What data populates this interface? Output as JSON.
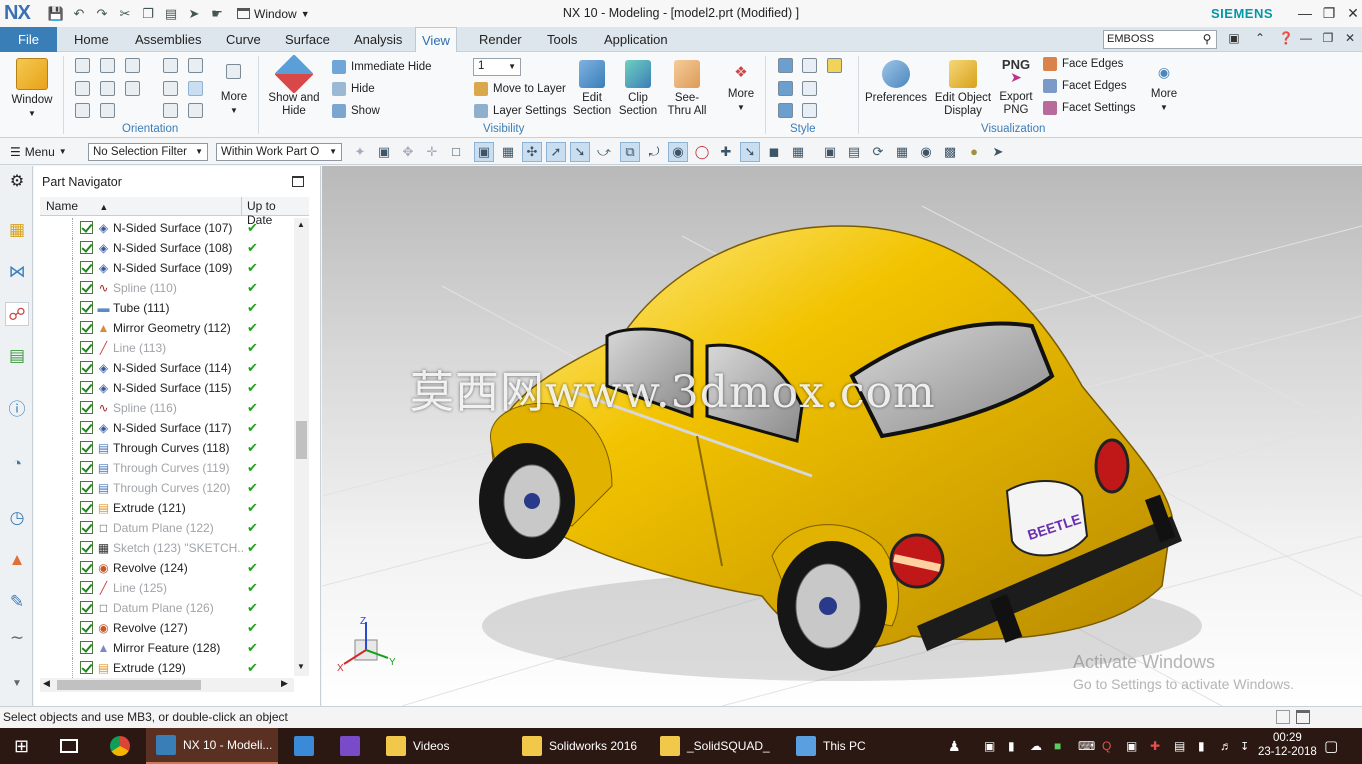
{
  "titlebar": {
    "logo": "NX",
    "window_menu": "Window",
    "title": "NX 10 - Modeling - [model2.prt (Modified) ]",
    "brand": "SIEMENS"
  },
  "tabs": {
    "file": "File",
    "items": [
      "Home",
      "Assemblies",
      "Curve",
      "Surface",
      "Analysis",
      "View",
      "Render",
      "Tools",
      "Application"
    ],
    "active": "View",
    "search_value": "EMBOSS"
  },
  "ribbon": {
    "window_label": "Window",
    "orientation_more": "More",
    "orientation_group": "Orientation",
    "show_and_hide": "Show and Hide",
    "immediate_hide": "Immediate Hide",
    "hide": "Hide",
    "show": "Show",
    "layer_value": "1",
    "move_to_layer": "Move to Layer",
    "layer_settings": "Layer Settings",
    "edit_section": "Edit Section",
    "clip_section": "Clip Section",
    "see_thru_all": "See-Thru All",
    "visibility_more": "More",
    "visibility_group": "Visibility",
    "style_group": "Style",
    "preferences": "Preferences",
    "edit_object_display": "Edit Object Display",
    "export_png_top": "PNG",
    "export_png": "Export PNG",
    "face_edges": "Face Edges",
    "facet_edges": "Facet Edges",
    "facet_settings": "Facet Settings",
    "visualization_more": "More",
    "visualization_group": "Visualization"
  },
  "toolbar": {
    "menu": "Menu",
    "selection_filter": "No Selection Filter",
    "scope": "Within Work Part O"
  },
  "navigator": {
    "title": "Part Navigator",
    "col_name": "Name",
    "col_uptodate": "Up to Date",
    "rows": [
      {
        "label": "N-Sided Surface (107)",
        "icon": "nsided-surface-icon",
        "dim": false
      },
      {
        "label": "N-Sided Surface (108)",
        "icon": "nsided-surface-icon",
        "dim": false
      },
      {
        "label": "N-Sided Surface (109)",
        "icon": "nsided-surface-icon",
        "dim": false
      },
      {
        "label": "Spline (110)",
        "icon": "spline-icon",
        "dim": true
      },
      {
        "label": "Tube (111)",
        "icon": "tube-icon",
        "dim": false
      },
      {
        "label": "Mirror Geometry (112)",
        "icon": "mirror-geometry-icon",
        "dim": false
      },
      {
        "label": "Line (113)",
        "icon": "line-icon",
        "dim": true
      },
      {
        "label": "N-Sided Surface (114)",
        "icon": "nsided-surface-icon",
        "dim": false
      },
      {
        "label": "N-Sided Surface (115)",
        "icon": "nsided-surface-icon",
        "dim": false
      },
      {
        "label": "Spline (116)",
        "icon": "spline-icon",
        "dim": true
      },
      {
        "label": "N-Sided Surface (117)",
        "icon": "nsided-surface-icon",
        "dim": false
      },
      {
        "label": "Through Curves (118)",
        "icon": "through-curves-icon",
        "dim": false
      },
      {
        "label": "Through Curves (119)",
        "icon": "through-curves-icon",
        "dim": true
      },
      {
        "label": "Through Curves (120)",
        "icon": "through-curves-icon",
        "dim": true
      },
      {
        "label": "Extrude (121)",
        "icon": "extrude-icon",
        "dim": false
      },
      {
        "label": "Datum Plane (122)",
        "icon": "datum-plane-icon",
        "dim": true
      },
      {
        "label": "Sketch (123) \"SKETCH...",
        "icon": "sketch-icon",
        "dim": true
      },
      {
        "label": "Revolve (124)",
        "icon": "revolve-icon",
        "dim": false
      },
      {
        "label": "Line (125)",
        "icon": "line-icon",
        "dim": true
      },
      {
        "label": "Datum Plane (126)",
        "icon": "datum-plane-icon",
        "dim": true
      },
      {
        "label": "Revolve (127)",
        "icon": "revolve-icon",
        "dim": false
      },
      {
        "label": "Mirror Feature (128)",
        "icon": "mirror-feature-icon",
        "dim": false
      },
      {
        "label": "Extrude (129)",
        "icon": "extrude-icon",
        "dim": false
      }
    ]
  },
  "viewport": {
    "watermark": "莫西网www.3dmox.com",
    "badge_text": "BEETLE",
    "triad_x": "X",
    "triad_y": "Y",
    "triad_z": "Z",
    "activate_title": "Activate Windows",
    "activate_sub": "Go to Settings to activate Windows."
  },
  "status": {
    "message": "Select objects and use MB3, or double-click an object"
  },
  "taskbar": {
    "items": [
      "NX 10 - Modeli...",
      "Videos",
      "Solidworks 2016",
      "_SolidSQUAD_",
      "This PC"
    ],
    "time": "00:29",
    "date": "23-12-2018"
  },
  "colors": {
    "accent": "#3a7eb8",
    "car_body": "#f2c300",
    "taskbar": "#2b1812",
    "check_green": "#1fa21f"
  }
}
